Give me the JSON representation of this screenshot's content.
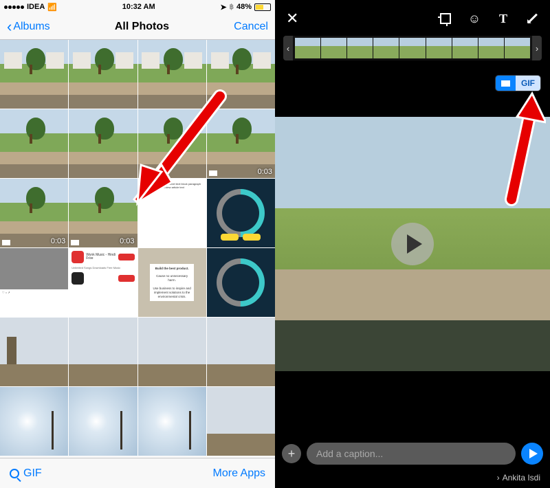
{
  "status": {
    "carrier": "IDEA",
    "time": "10:32 AM",
    "battery": "48%"
  },
  "nav": {
    "back": "Albums",
    "title": "All Photos",
    "cancel": "Cancel"
  },
  "videos": {
    "duration": "0:03"
  },
  "poster": {
    "h1": "Build the best product.",
    "h2": "Cause no unnecessary harm.",
    "h3": "Use business to inspire and implement solutions to the environmental crisis."
  },
  "bottom": {
    "gif": "GIF",
    "more": "More Apps"
  },
  "right": {
    "gif_label": "GIF",
    "caption_placeholder": "Add a caption...",
    "recipient": "Ankita Isdi"
  }
}
